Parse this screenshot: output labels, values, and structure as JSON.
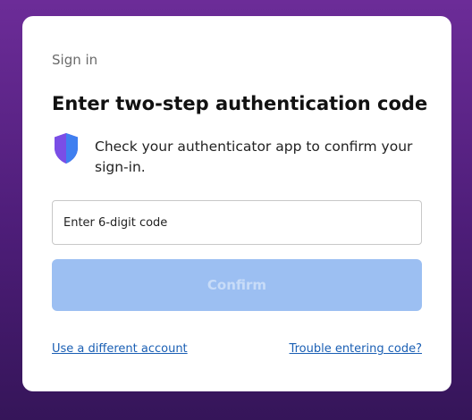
{
  "background": {
    "gradient_top": "#6c2c98",
    "gradient_bottom": "#351559"
  },
  "card": {
    "subtitle": "Sign in",
    "title": "Enter two-step authentication code",
    "shield_icon": "shield-icon",
    "message": "Check your authenticator app to confirm your sign-in.",
    "code_input": {
      "placeholder": "Enter 6-digit code",
      "value": ""
    },
    "confirm_button": {
      "label": "Confirm",
      "disabled": true,
      "color": "#9cbff2"
    },
    "links": {
      "different_account": "Use a different account",
      "trouble": "Trouble entering code?"
    },
    "link_color": "#1a5fb4"
  }
}
